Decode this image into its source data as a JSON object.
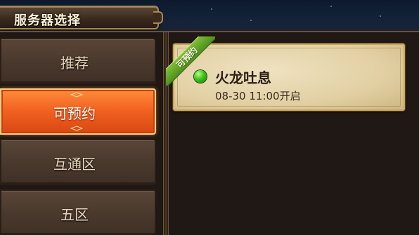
{
  "header": {
    "title": "服务器选择"
  },
  "sidebar": {
    "items": [
      {
        "label": "推荐",
        "active": false
      },
      {
        "label": "可预约",
        "active": true
      },
      {
        "label": "互通区",
        "active": false
      },
      {
        "label": "五区",
        "active": false
      }
    ]
  },
  "servers": [
    {
      "badge": "可预约",
      "name": "火龙吐息",
      "time": "08-30 11:00开启",
      "status_color": "#3fc21d"
    }
  ],
  "colors": {
    "accent": "#f26322",
    "gold_border": "#a8884f",
    "card_bg": "#e2d0a4"
  }
}
